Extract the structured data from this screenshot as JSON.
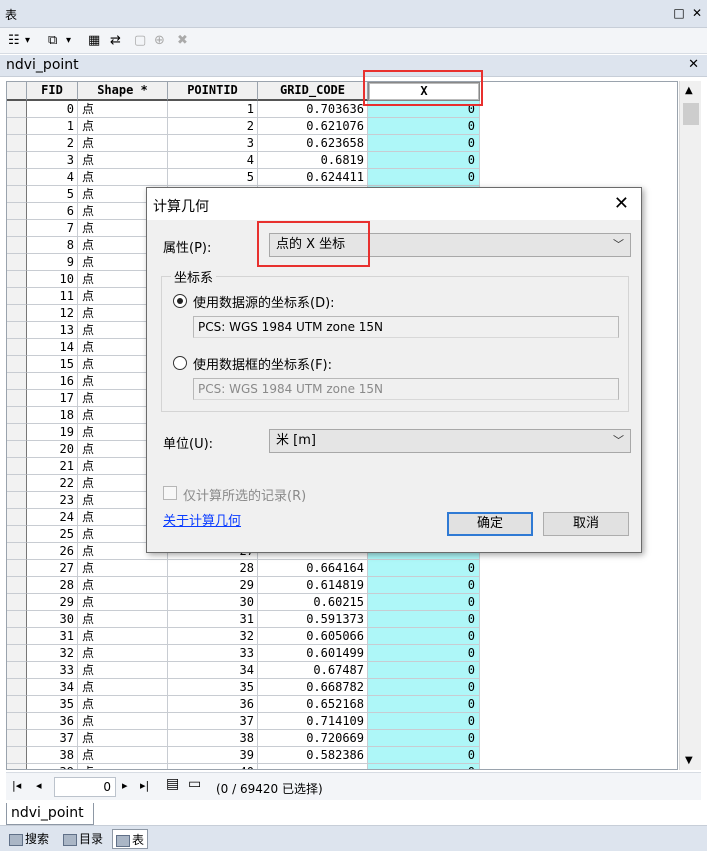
{
  "window": {
    "title": "表",
    "min_glyph": "□",
    "close_glyph": "✕"
  },
  "toolbar": {
    "icons": [
      "table-options-icon",
      "relate-icon",
      "select-by-attributes-icon",
      "switch-selection-icon",
      "clear-selection-icon",
      "zoom-to-selected-icon",
      "delete-selected-icon"
    ],
    "dropdown_glyph": "▾"
  },
  "table_tab": {
    "title": "ndvi_point",
    "close_glyph": "✕"
  },
  "grid": {
    "columns": [
      "FID",
      "Shape *",
      "POINTID",
      "GRID_CODE",
      "X"
    ],
    "rows": [
      [
        "0",
        "点",
        "1",
        "0.703636",
        "0"
      ],
      [
        "1",
        "点",
        "2",
        "0.621076",
        "0"
      ],
      [
        "2",
        "点",
        "3",
        "0.623658",
        "0"
      ],
      [
        "3",
        "点",
        "4",
        "0.6819",
        "0"
      ],
      [
        "4",
        "点",
        "5",
        "0.624411",
        "0"
      ],
      [
        "5",
        "点",
        "",
        "",
        ""
      ],
      [
        "6",
        "点",
        "",
        "",
        ""
      ],
      [
        "7",
        "点",
        "",
        "",
        ""
      ],
      [
        "8",
        "点",
        "",
        "",
        ""
      ],
      [
        "9",
        "点",
        "",
        "",
        ""
      ],
      [
        "10",
        "点",
        "",
        "",
        ""
      ],
      [
        "11",
        "点",
        "",
        "",
        ""
      ],
      [
        "12",
        "点",
        "",
        "",
        ""
      ],
      [
        "13",
        "点",
        "",
        "",
        ""
      ],
      [
        "14",
        "点",
        "",
        "",
        ""
      ],
      [
        "15",
        "点",
        "",
        "",
        ""
      ],
      [
        "16",
        "点",
        "",
        "",
        ""
      ],
      [
        "17",
        "点",
        "",
        "",
        ""
      ],
      [
        "18",
        "点",
        "",
        "",
        ""
      ],
      [
        "19",
        "点",
        "",
        "",
        ""
      ],
      [
        "20",
        "点",
        "",
        "",
        ""
      ],
      [
        "21",
        "点",
        "",
        "",
        ""
      ],
      [
        "22",
        "点",
        "",
        "",
        ""
      ],
      [
        "23",
        "点",
        "",
        "",
        ""
      ],
      [
        "24",
        "点",
        "",
        "",
        ""
      ],
      [
        "25",
        "点",
        "",
        "",
        ""
      ],
      [
        "26",
        "点",
        "27",
        "",
        ""
      ],
      [
        "27",
        "点",
        "28",
        "0.664164",
        "0"
      ],
      [
        "28",
        "点",
        "29",
        "0.614819",
        "0"
      ],
      [
        "29",
        "点",
        "30",
        "0.60215",
        "0"
      ],
      [
        "30",
        "点",
        "31",
        "0.591373",
        "0"
      ],
      [
        "31",
        "点",
        "32",
        "0.605066",
        "0"
      ],
      [
        "32",
        "点",
        "33",
        "0.601499",
        "0"
      ],
      [
        "33",
        "点",
        "34",
        "0.67487",
        "0"
      ],
      [
        "34",
        "点",
        "35",
        "0.668782",
        "0"
      ],
      [
        "35",
        "点",
        "36",
        "0.652168",
        "0"
      ],
      [
        "36",
        "点",
        "37",
        "0.714109",
        "0"
      ],
      [
        "37",
        "点",
        "38",
        "0.720669",
        "0"
      ],
      [
        "38",
        "点",
        "39",
        "0.582386",
        "0"
      ],
      [
        "39",
        "点",
        "40",
        "",
        "0"
      ]
    ]
  },
  "navigation": {
    "first_glyph": "|◂",
    "prev_glyph": "◂",
    "current": "0",
    "next_glyph": "▸",
    "last_glyph": "▸|",
    "selection_status": "(0 / 69420 已选择)"
  },
  "bottom_tab": "ndvi_point",
  "bottom_bar": {
    "search": "搜索",
    "catalog": "目录",
    "table": "表"
  },
  "dialog": {
    "title": "计算几何",
    "close_glyph": "✕",
    "property_label": "属性(P):",
    "property_value": "点的 X 坐标",
    "coord_group_title": "坐标系",
    "use_source_label": "使用数据源的坐标系(D):",
    "source_cs": "PCS: WGS 1984 UTM zone 15N",
    "use_frame_label": "使用数据框的坐标系(F):",
    "frame_cs": "PCS: WGS 1984 UTM zone 15N",
    "units_label": "单位(U):",
    "units_value": "米 [m]",
    "selected_only_label": "仅计算所选的记录(R)",
    "about_link": "关于计算几何",
    "ok": "确定",
    "cancel": "取消",
    "chevron": "﹀"
  }
}
